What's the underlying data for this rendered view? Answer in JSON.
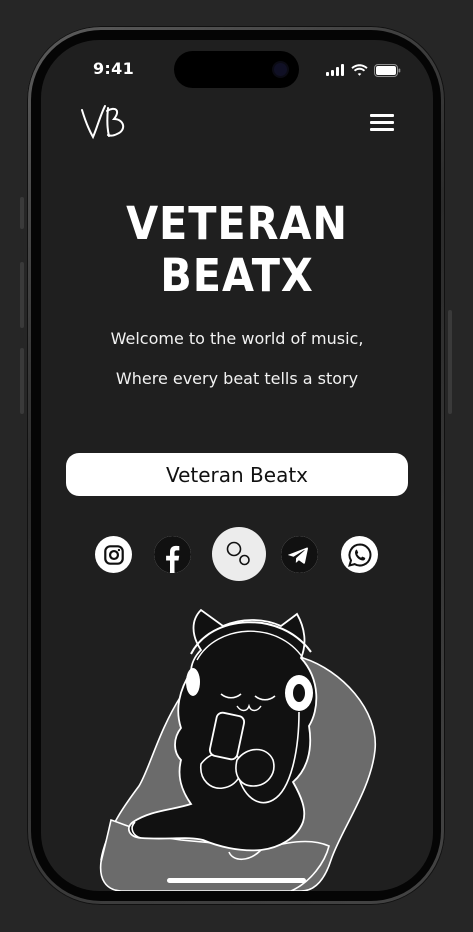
{
  "status_bar": {
    "time": "9:41"
  },
  "header": {
    "logo_text": "VB"
  },
  "hero": {
    "title_line1": "VETERAN",
    "title_line2": "BEATX",
    "tagline_line1": "Welcome to the world of music,",
    "tagline_line2": "Where every beat tells a story"
  },
  "cta": {
    "label": "Veteran Beatx"
  },
  "social_links": [
    "instagram-icon",
    "facebook-icon",
    "bubbles-icon",
    "telegram-icon",
    "whatsapp-icon"
  ],
  "illustration": "cat-with-headphones-in-armchair",
  "colors": {
    "background": "#1f1f1f",
    "accent": "#ffffff",
    "chair": "#6b6b6b"
  }
}
